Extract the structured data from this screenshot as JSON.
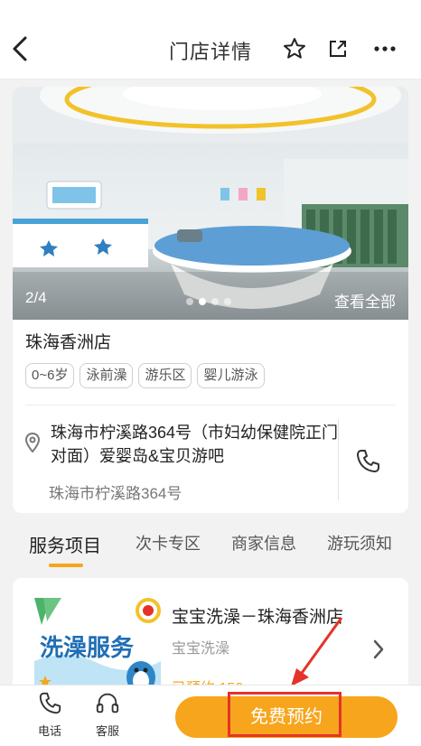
{
  "nav": {
    "title": "门店详情",
    "icons": [
      "back-arrow-icon",
      "star-icon",
      "share-icon",
      "more-icon"
    ]
  },
  "gallery": {
    "counter": "2/4",
    "dot_count": 4,
    "active_dot": 1,
    "view_all": "查看全部"
  },
  "store": {
    "name": "珠海香洲店",
    "tags": [
      "0~6岁",
      "泳前澡",
      "游乐区",
      "婴儿游泳"
    ],
    "address_main": "珠海市柠溪路364号（市妇幼保健院正门对面）爱婴岛&宝贝游吧",
    "address_sub": "珠海市柠溪路364号"
  },
  "tabs": [
    "服务项目",
    "次卡专区",
    "商家信息",
    "游玩须知"
  ],
  "active_tab": 0,
  "service": {
    "title": "宝宝洗澡－珠海香洲店",
    "subtitle": "宝宝洗澡",
    "booked": "已预约 150",
    "thumb_text": "洗澡服务"
  },
  "bottom": {
    "phone_label": "电话",
    "service_label": "客服",
    "book_label": "免费预约"
  },
  "colors": {
    "accent": "#f7a51c",
    "highlight": "#e5332a",
    "text_primary": "#222222",
    "text_secondary": "#999999"
  }
}
